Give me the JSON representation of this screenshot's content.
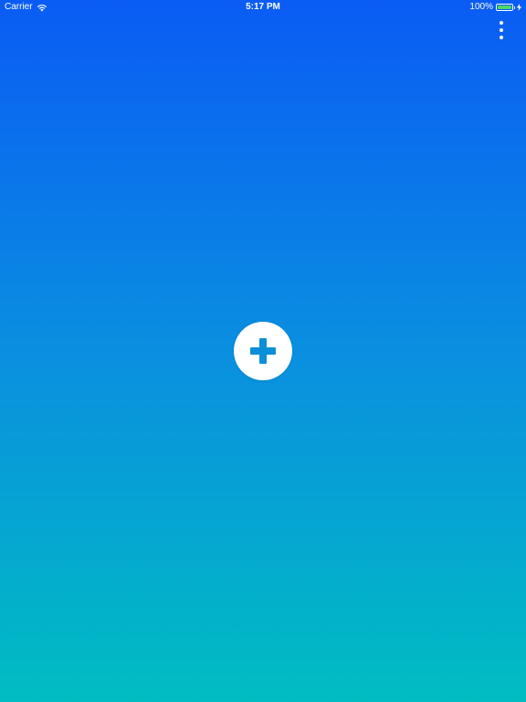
{
  "status_bar": {
    "carrier": "Carrier",
    "time": "5:17 PM",
    "battery_percent": "100%",
    "battery_level": 1.0,
    "icons": {
      "wifi": "wifi-icon",
      "battery": "battery-icon",
      "charging": "charging-bolt-icon"
    }
  },
  "toolbar": {
    "menu_icon": "more-vertical-icon"
  },
  "main": {
    "add_icon": "plus-icon"
  },
  "colors": {
    "gradient_top": "#0a5cf4",
    "gradient_bottom": "#00bdc2",
    "plus_color": "#0a8fd8",
    "battery_fill": "#4cd964"
  }
}
